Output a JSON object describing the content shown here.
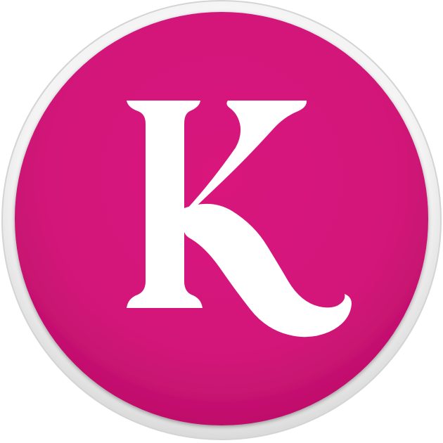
{
  "icon": {
    "name": "app-logo-icon",
    "letter": "K",
    "colors": {
      "background": "#ffffff",
      "ring": "#f1f1f1",
      "ring_edge": "#d6d6d6",
      "fill": "#d6177a",
      "fill_dark": "#c0106b",
      "letter": "#ffffff"
    }
  }
}
